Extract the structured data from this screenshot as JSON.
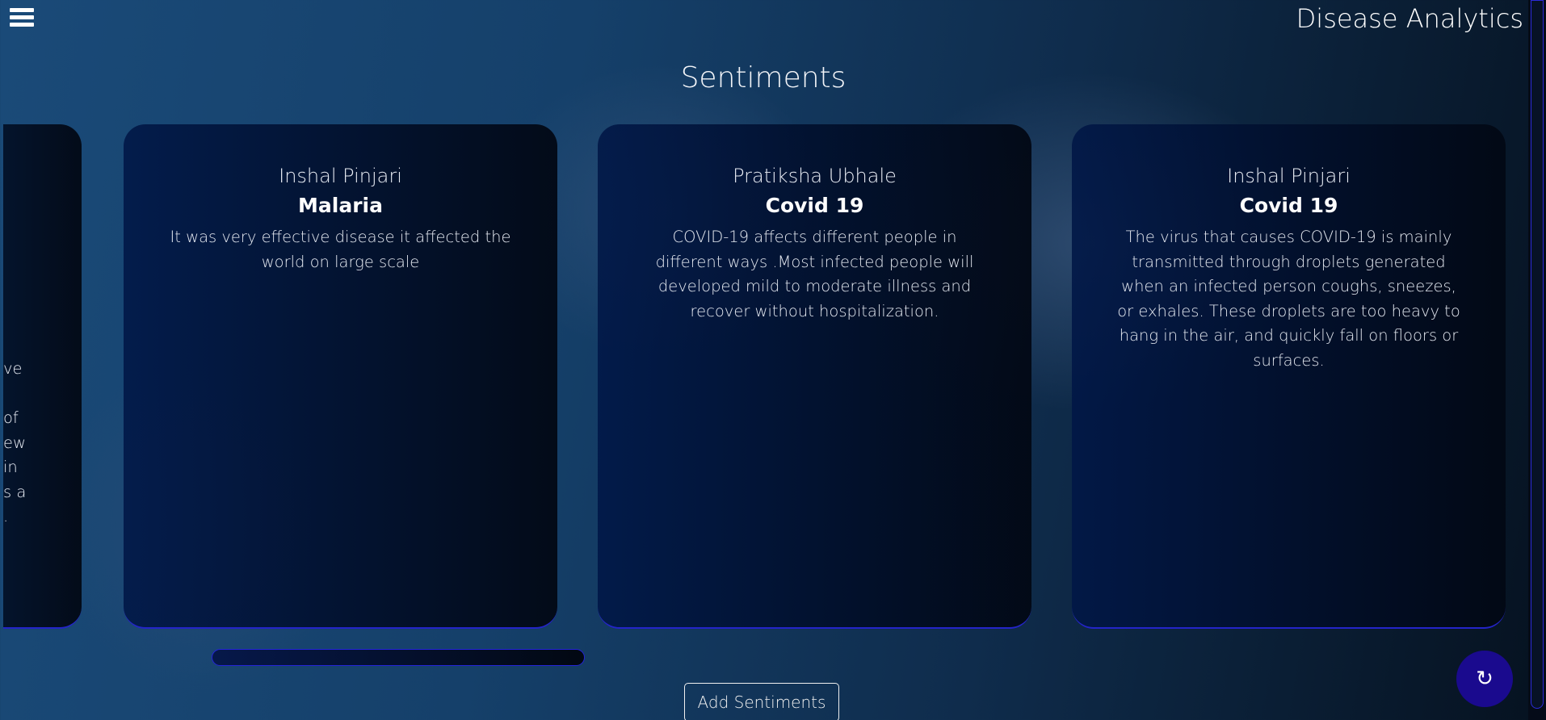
{
  "header": {
    "menu_icon": "hamburger-icon",
    "brand": "Disease Analytics"
  },
  "page": {
    "title": "Sentiments"
  },
  "partial_card": {
    "lines": [
      "ve",
      "",
      "of",
      "ew",
      "in",
      "s a",
      "."
    ]
  },
  "cards": [
    {
      "name": "Inshal Pinjari",
      "disease": "Malaria",
      "text": "It was very effective disease it affected the world on large scale"
    },
    {
      "name": "Pratiksha Ubhale",
      "disease": "Covid 19",
      "text": "COVID-19 affects different people in different ways .Most infected people will developed mild to moderate illness and recover without hospitalization."
    },
    {
      "name": "Inshal Pinjari",
      "disease": "Covid 19",
      "text": "The virus that causes COVID-19 is mainly transmitted through droplets generated when an infected person coughs, sneezes, or exhales. These droplets are too heavy to hang in the air, and quickly fall on floors or surfaces."
    }
  ],
  "actions": {
    "add_label": "Add Sentiments",
    "refresh_icon": "refresh-icon"
  },
  "colors": {
    "accent": "#1a0a8e",
    "border": "#2424c8"
  }
}
